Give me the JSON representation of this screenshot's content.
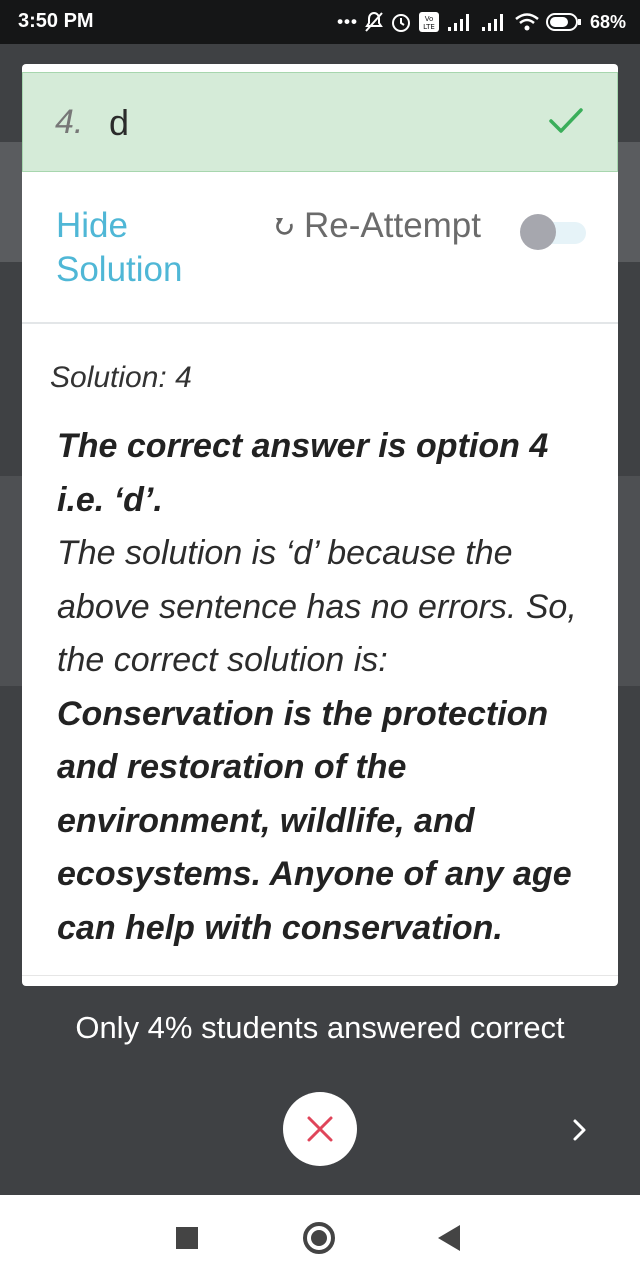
{
  "status_bar": {
    "time": "3:50 PM",
    "battery": "68%"
  },
  "question": {
    "option_number": "4.",
    "option_text": "d",
    "status_icon": "check-icon",
    "correct_color": "#d5ebd8"
  },
  "actions": {
    "hide_solution": "Hide Solution",
    "reattempt": "Re-Attempt",
    "reattempt_enabled": false
  },
  "solution": {
    "label": "Solution: 4",
    "heading": "The correct answer is option 4 i.e. ‘d’.",
    "explanation": "The solution is ‘d’ because the above sentence has no errors. So, the correct solution is:",
    "corrected_sentence": "Conservation is the protection and restoration of the environment, wildlife, and ecosystems. Anyone of any age can help with conservation."
  },
  "stats": {
    "text": "Only 4% students answered correct"
  },
  "colors": {
    "accent": "#4fb7d6",
    "success": "#3aae5a",
    "error": "#e0455a"
  }
}
